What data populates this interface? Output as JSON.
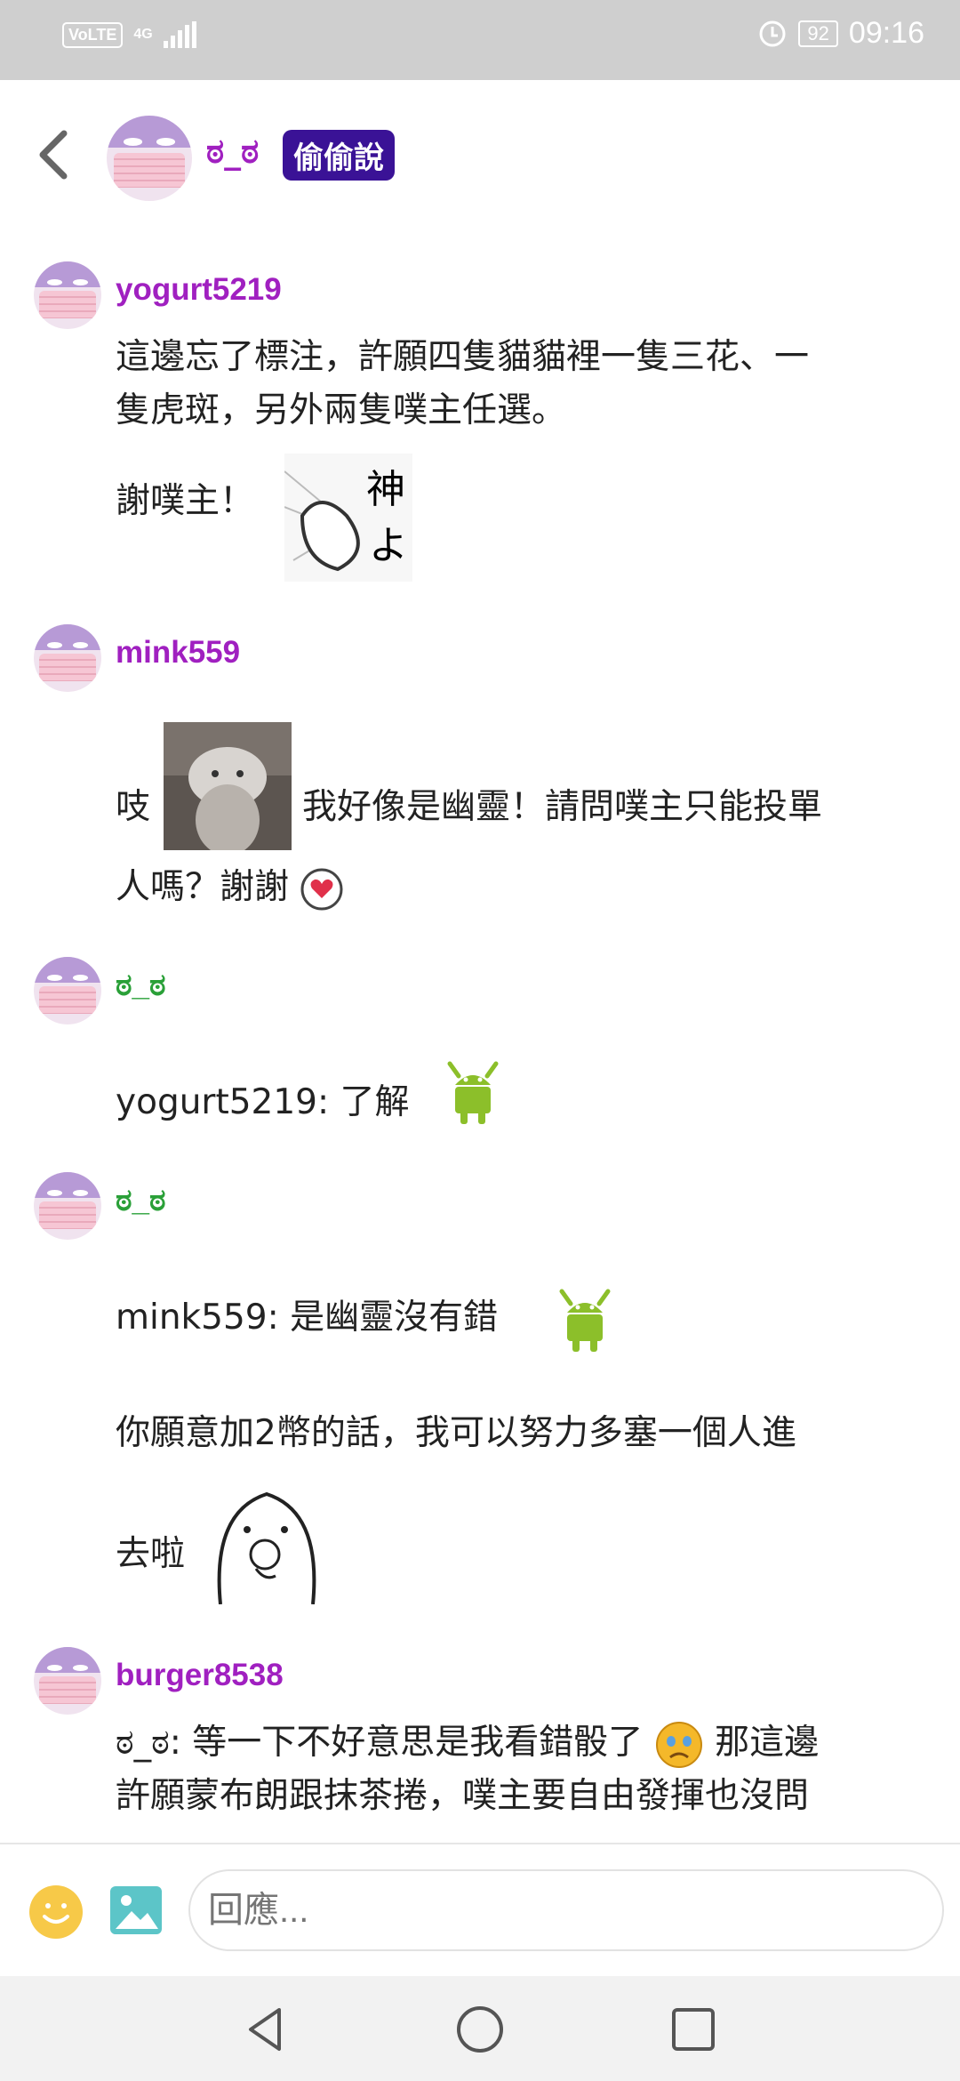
{
  "status": {
    "volte": "VoLTE",
    "network": "4G",
    "battery": "92",
    "time": "09:16"
  },
  "header": {
    "name": "ಠ_ಠ",
    "badge": "偷偷說"
  },
  "posts": [
    {
      "user": "yogurt5219",
      "lines": [
        "這邊忘了標注，許願四隻貓貓裡一隻三花、一",
        "隻虎斑，另外兩隻噗主任選。"
      ],
      "after": "謝噗主！"
    },
    {
      "user": "mink559",
      "a": "吱",
      "b": "我好像是幽靈！請問噗主只能投單",
      "c": "人嗎？謝謝"
    },
    {
      "user": "ಠ_ಠ",
      "text": "yogurt5219: 了解"
    },
    {
      "user": "ಠ_ಠ",
      "text": "mink559: 是幽靈沒有錯",
      "text2": "你願意加2幣的話，我可以努力多塞一個人進",
      "text3": "去啦"
    },
    {
      "user": "burger8538",
      "a": "ಠ_ಠ: 等一下不好意思是我看錯骰了",
      "b": "那這邊",
      "c": "許願蒙布朗跟抹茶捲，噗主要自由發揮也沒問"
    }
  ],
  "input": {
    "placeholder": "回應..."
  },
  "colors": {
    "username_purple": "#a020c0",
    "username_green": "#2aa038",
    "badge_bg": "#3a1296"
  }
}
